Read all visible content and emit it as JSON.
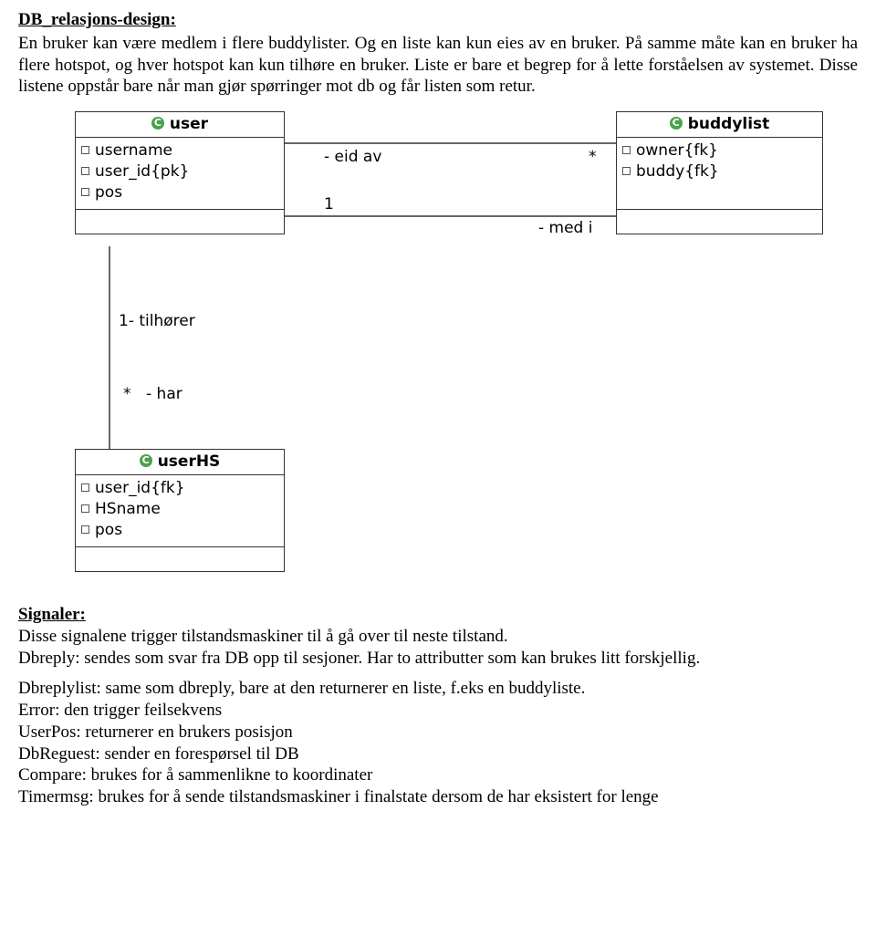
{
  "section1": {
    "heading": "DB_relasjons-design:",
    "para1": "En bruker kan være medlem i flere buddylister. Og en liste kan kun eies av en bruker. På samme måte kan en bruker ha flere hotspot, og hver hotspot kan kun tilhøre en  bruker. Liste er bare et begrep for å lette forståelsen av systemet. Disse listene oppstår bare når man gjør spørringer mot db og får listen som retur."
  },
  "diagram": {
    "tables": {
      "user": {
        "title": "user",
        "attrs": [
          "username",
          "user_id{pk}",
          "pos"
        ]
      },
      "buddylist": {
        "title": "buddylist",
        "attrs": [
          "owner{fk}",
          "buddy{fk}"
        ]
      },
      "userHS": {
        "title": "userHS",
        "attrs": [
          "user_id{fk}",
          "HSname",
          "pos"
        ]
      }
    },
    "labels": {
      "eid": "- eid av",
      "star1": "*",
      "one1": "1",
      "medi": "- med i",
      "one_til": "1- tilhører",
      "star2": "*",
      "har": "- har"
    }
  },
  "section2": {
    "heading": "Signaler:",
    "line1": "Disse signalene trigger tilstandsmaskiner til å gå over til neste tilstand.",
    "line2": "Dbreply: sendes som svar fra DB opp til sesjoner. Har to attributter som kan brukes litt forskjellig.",
    "line3": "Dbreplylist: same som dbreply, bare at den returnerer en liste, f.eks en buddyliste.",
    "line4": "Error: den trigger feilsekvens",
    "line5": "UserPos: returnerer en brukers posisjon",
    "line6": "DbReguest: sender en forespørsel til DB",
    "line7": "Compare: brukes for å sammenlikne to koordinater",
    "line8": "Timermsg: brukes for å sende tilstandsmaskiner i finalstate dersom de har eksistert for lenge"
  }
}
